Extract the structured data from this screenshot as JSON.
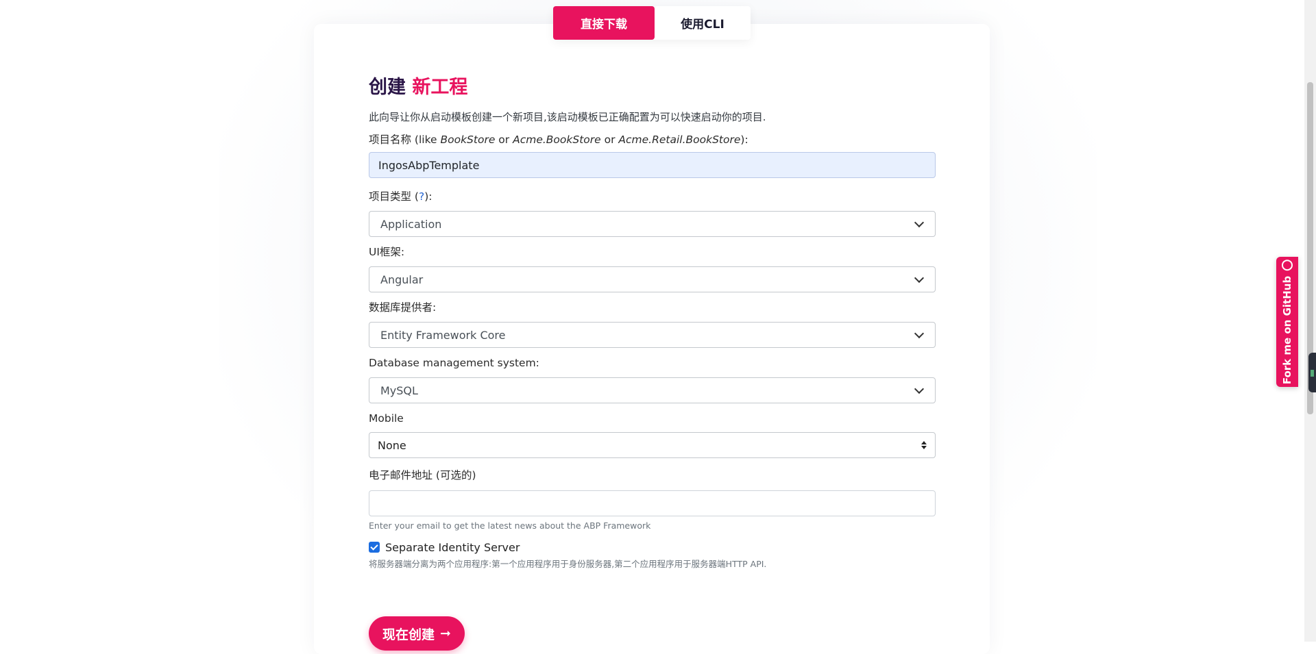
{
  "tabs": [
    {
      "label": "直接下载",
      "active": true
    },
    {
      "label": "使用CLI",
      "active": false
    }
  ],
  "heading": {
    "part1": "创建",
    "part2": "新工程"
  },
  "lead": "此向导让你从启动模板创建一个新项目,该启动模板已正确配置为可以快速启动你的项目.",
  "project_name": {
    "label_prefix": "项目名称 (like ",
    "ex1": "BookStore",
    "or1": " or ",
    "ex2": "Acme.BookStore",
    "or2": " or ",
    "ex3": "Acme.Retail.BookStore",
    "label_suffix": "):",
    "value": "IngosAbpTemplate"
  },
  "project_type": {
    "label_prefix": "项目类型 (",
    "help": "?",
    "label_suffix": "):",
    "value": "Application"
  },
  "ui_framework": {
    "label": "UI框架:",
    "value": "Angular"
  },
  "db_provider": {
    "label": "数据库提供者:",
    "value": "Entity Framework Core"
  },
  "dbms": {
    "label": "Database management system:",
    "value": "MySQL"
  },
  "mobile": {
    "label": "Mobile",
    "value": "None"
  },
  "email": {
    "label": "电子邮件地址 (可选的)",
    "value": "",
    "hint": "Enter your email to get the latest news about the ABP Framework"
  },
  "separate_identity": {
    "label": "Separate Identity Server",
    "checked": true,
    "hint": "将服务器端分离为两个应用程序:第一个应用程序用于身份服务器,第二个应用程序用于服务器端HTTP API."
  },
  "create_button": {
    "label": "现在创建",
    "arrow": "➞"
  },
  "fork_ribbon": {
    "label": "Fork me on GitHub",
    "icon": "github-icon"
  },
  "colors": {
    "accent": "#e8135e",
    "heading": "#2a1547",
    "link": "#2565d1",
    "check": "#1c6de0"
  }
}
